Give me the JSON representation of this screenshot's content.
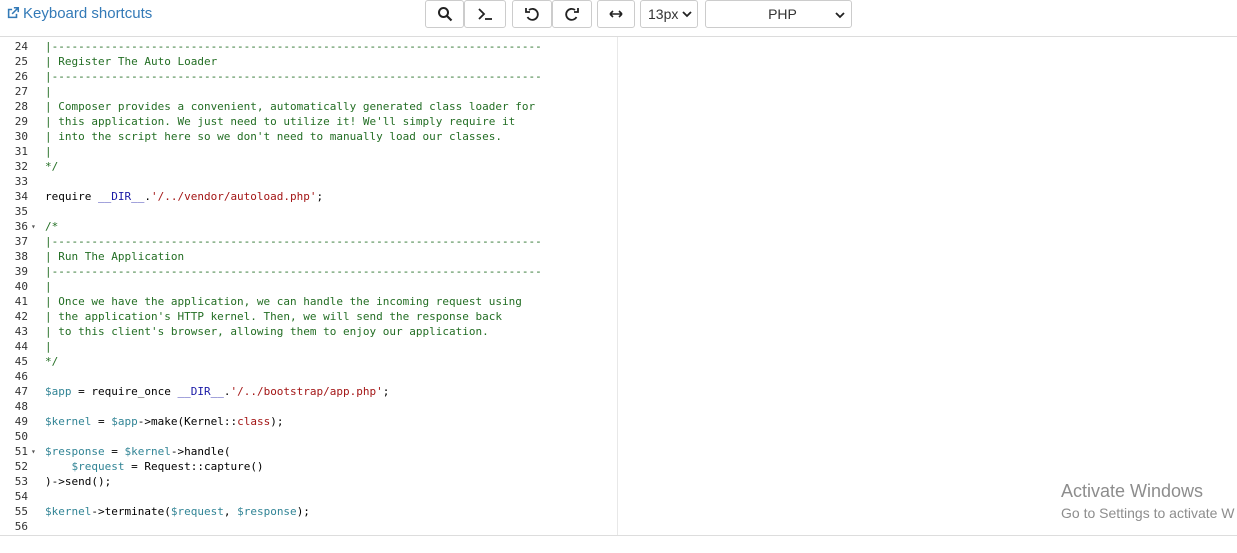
{
  "toolbar": {
    "keyboard_shortcuts": "Keyboard shortcuts",
    "font_size": "13px",
    "language": "PHP",
    "icons": [
      "search-icon",
      "terminal-icon",
      "undo-icon",
      "redo-icon",
      "wrap-icon",
      "chevron-down-icon"
    ]
  },
  "editor": {
    "lines": [
      {
        "n": "24",
        "fold": "",
        "html": "<span class=\"c\">|--------------------------------------------------------------------------</span>"
      },
      {
        "n": "25",
        "fold": "",
        "html": "<span class=\"c\">| Register The Auto Loader</span>"
      },
      {
        "n": "26",
        "fold": "",
        "html": "<span class=\"c\">|--------------------------------------------------------------------------</span>"
      },
      {
        "n": "27",
        "fold": "",
        "html": "<span class=\"c\">|</span>"
      },
      {
        "n": "28",
        "fold": "",
        "html": "<span class=\"c\">| Composer provides a convenient, automatically generated class loader for</span>"
      },
      {
        "n": "29",
        "fold": "",
        "html": "<span class=\"c\">| this application. We just need to utilize it! We'll simply require it</span>"
      },
      {
        "n": "30",
        "fold": "",
        "html": "<span class=\"c\">| into the script here so we don't need to manually load our classes.</span>"
      },
      {
        "n": "31",
        "fold": "",
        "html": "<span class=\"c\">|</span>"
      },
      {
        "n": "32",
        "fold": "",
        "html": "<span class=\"c\">*/</span>"
      },
      {
        "n": "33",
        "fold": "",
        "html": ""
      },
      {
        "n": "34",
        "fold": "",
        "html": "require <span class=\"s\">__DIR__</span>.<span class=\"k\">'/../vendor/autoload.php'</span>;"
      },
      {
        "n": "35",
        "fold": "",
        "html": ""
      },
      {
        "n": "36",
        "fold": "▾",
        "html": "<span class=\"c\">/*</span>"
      },
      {
        "n": "37",
        "fold": "",
        "html": "<span class=\"c\">|--------------------------------------------------------------------------</span>"
      },
      {
        "n": "38",
        "fold": "",
        "html": "<span class=\"c\">| Run The Application</span>"
      },
      {
        "n": "39",
        "fold": "",
        "html": "<span class=\"c\">|--------------------------------------------------------------------------</span>"
      },
      {
        "n": "40",
        "fold": "",
        "html": "<span class=\"c\">|</span>"
      },
      {
        "n": "41",
        "fold": "",
        "html": "<span class=\"c\">| Once we have the application, we can handle the incoming request using</span>"
      },
      {
        "n": "42",
        "fold": "",
        "html": "<span class=\"c\">| the application's HTTP kernel. Then, we will send the response back</span>"
      },
      {
        "n": "43",
        "fold": "",
        "html": "<span class=\"c\">| to this client's browser, allowing them to enjoy our application.</span>"
      },
      {
        "n": "44",
        "fold": "",
        "html": "<span class=\"c\">|</span>"
      },
      {
        "n": "45",
        "fold": "",
        "html": "<span class=\"c\">*/</span>"
      },
      {
        "n": "46",
        "fold": "",
        "html": ""
      },
      {
        "n": "47",
        "fold": "",
        "html": "<span class=\"v\">$app</span> = require_once <span class=\"s\">__DIR__</span>.<span class=\"k\">'/../bootstrap/app.php'</span>;"
      },
      {
        "n": "48",
        "fold": "",
        "html": ""
      },
      {
        "n": "49",
        "fold": "",
        "html": "<span class=\"v\">$kernel</span> = <span class=\"v\">$app</span>-&gt;make(Kernel::<span class=\"k\">class</span>);"
      },
      {
        "n": "50",
        "fold": "",
        "html": ""
      },
      {
        "n": "51",
        "fold": "▾",
        "html": "<span class=\"v\">$response</span> = <span class=\"v\">$kernel</span>-&gt;handle("
      },
      {
        "n": "52",
        "fold": "",
        "html": "    <span class=\"v\">$request</span> = Request::capture()"
      },
      {
        "n": "53",
        "fold": "",
        "html": ")-&gt;send();"
      },
      {
        "n": "54",
        "fold": "",
        "html": ""
      },
      {
        "n": "55",
        "fold": "",
        "html": "<span class=\"v\">$kernel</span>-&gt;terminate(<span class=\"v\">$request</span>, <span class=\"v\">$response</span>);"
      },
      {
        "n": "56",
        "fold": "",
        "html": ""
      }
    ]
  },
  "watermark": {
    "title": "Activate Windows",
    "subtitle": "Go to Settings to activate W"
  }
}
